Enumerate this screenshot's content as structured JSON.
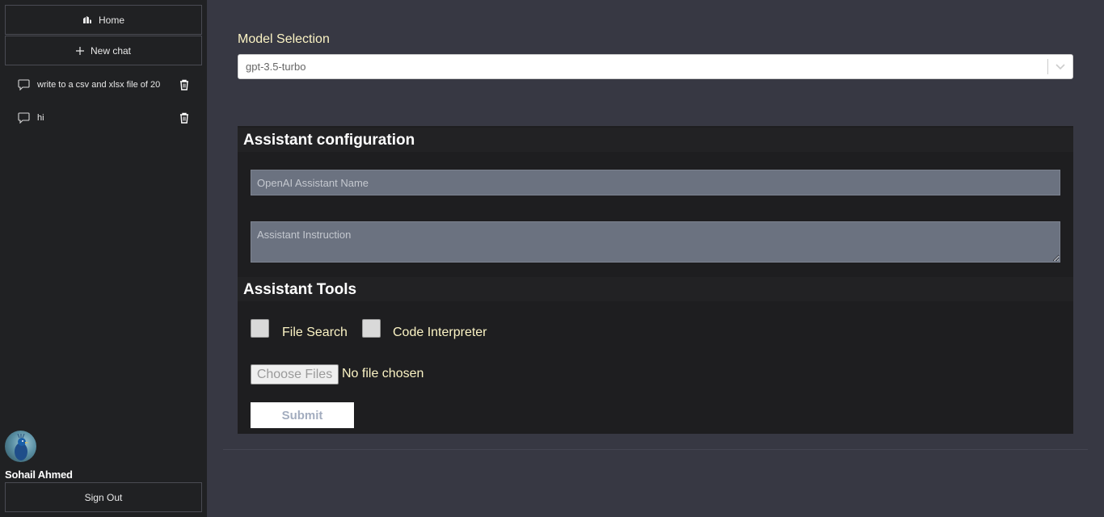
{
  "sidebar": {
    "home_label": "Home",
    "new_chat_label": "New chat",
    "chats": [
      {
        "label": "write to a csv and xlsx file of 20"
      },
      {
        "label": "hi"
      }
    ],
    "user_name": "Sohail Ahmed",
    "sign_out_label": "Sign Out"
  },
  "model": {
    "label": "Model Selection",
    "selected": "gpt-3.5-turbo"
  },
  "assistant": {
    "config_title": "Assistant configuration",
    "name_placeholder": "OpenAI Assistant Name",
    "instruction_placeholder": "Assistant Instruction",
    "tools_title": "Assistant Tools",
    "tools": [
      "File Search",
      "Code Interpreter"
    ],
    "file_button_label": "Choose Files",
    "file_status": "No file chosen",
    "submit_label": "Submit"
  },
  "colors": {
    "sidebar_bg": "#202123",
    "main_bg": "#373843",
    "panel_bg": "#1e1e20",
    "accent_text": "#fbf3c4",
    "field_bg": "#6b7280"
  },
  "icons": [
    "home-icon",
    "plus-icon",
    "chat-bubble-icon",
    "trash-icon",
    "chevron-down-icon"
  ]
}
